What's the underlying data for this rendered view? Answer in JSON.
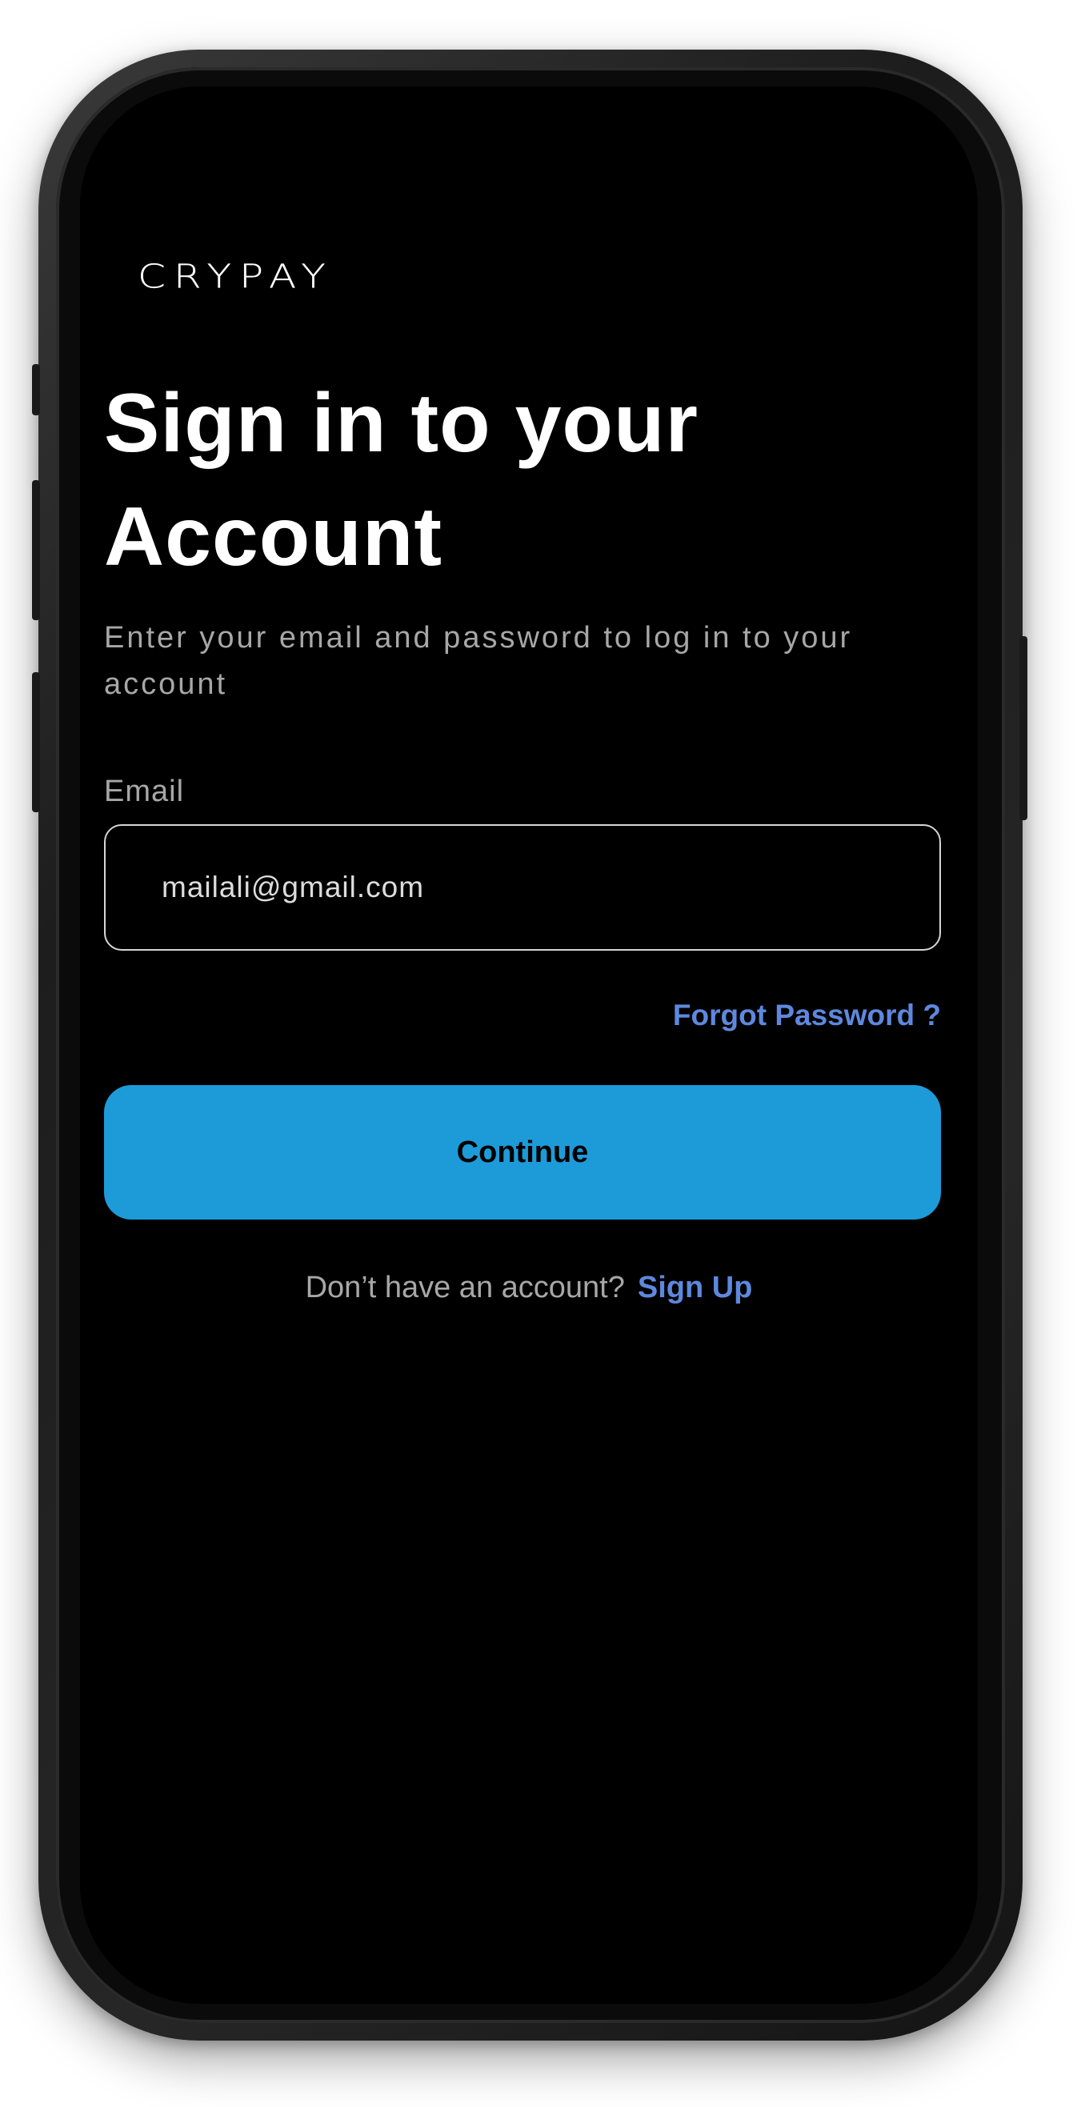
{
  "app": {
    "logo_text": "CRYPAY"
  },
  "header": {
    "title": "Sign in to your Account",
    "subtitle": "Enter your email and password to log in to your account"
  },
  "form": {
    "email_label": "Email",
    "email_value": "mailali@gmail.com",
    "forgot_password_label": "Forgot Password ?",
    "continue_label": "Continue"
  },
  "footer": {
    "signup_prompt": "Don’t have an account?",
    "signup_label": "Sign Up"
  },
  "colors": {
    "background": "#000000",
    "accent_button": "#1d9bd9",
    "link": "#5e88de",
    "muted_text": "#a7a7a7"
  }
}
